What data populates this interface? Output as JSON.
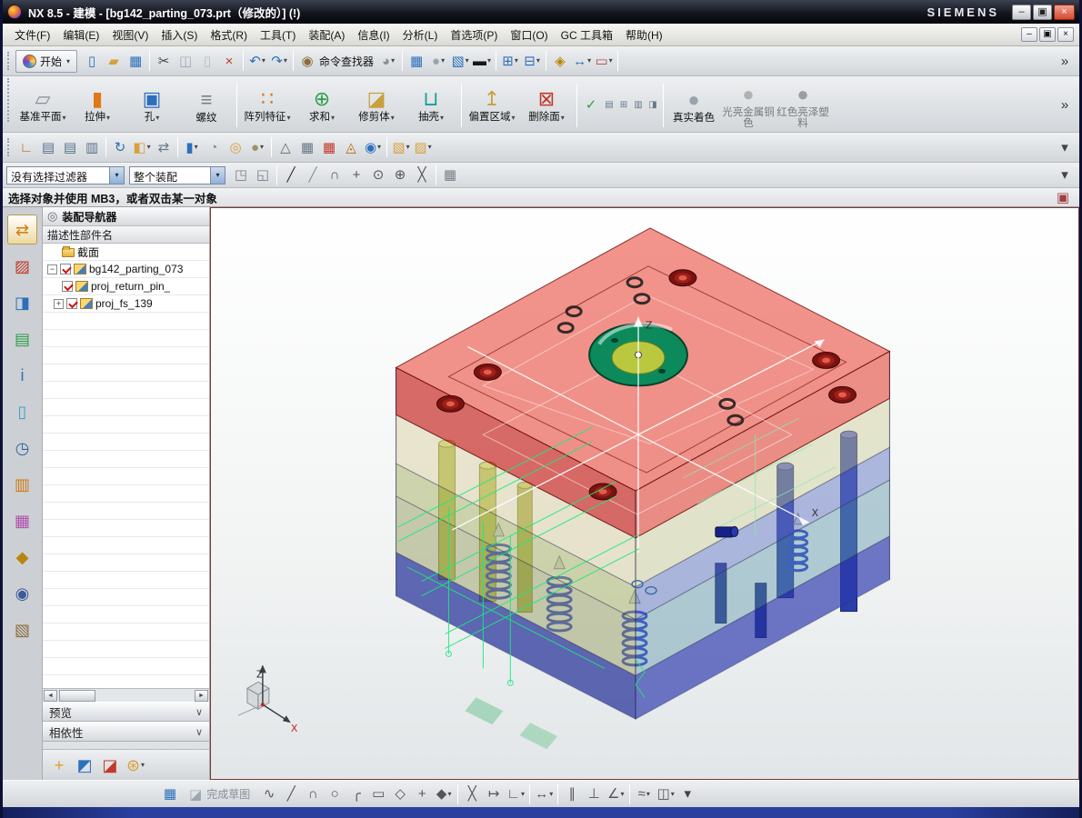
{
  "window": {
    "title": "NX 8.5 - 建模 - [bg142_parting_073.prt（修改的）] (!)",
    "brand": "SIEMENS"
  },
  "glyphs": {
    "overflow": "»",
    "chevron": "∨",
    "exp_open": "−",
    "exp_closed": "+",
    "sleft": "◄",
    "sright": "►",
    "combo": "▾",
    "min": "–",
    "restore": "▣",
    "close": "×",
    "nav": "◎"
  },
  "menu": {
    "items": [
      "文件(F)",
      "编辑(E)",
      "视图(V)",
      "插入(S)",
      "格式(R)",
      "工具(T)",
      "装配(A)",
      "信息(I)",
      "分析(L)",
      "首选项(P)",
      "窗口(O)",
      "GC 工具箱",
      "帮助(H)"
    ]
  },
  "toolbar1": {
    "start": "开始",
    "command_finder": "命令查找器",
    "a": [
      {
        "n": "new-file",
        "g": "▯",
        "c": "#2d6fbb"
      },
      {
        "n": "open-folder",
        "g": "▰",
        "c": "#d9a03c"
      },
      {
        "n": "save",
        "g": "▦",
        "c": "#2d6fbb"
      },
      {
        "sep": true
      },
      {
        "n": "cut",
        "g": "✂",
        "c": "#444444"
      },
      {
        "n": "copy",
        "g": "◫",
        "c": "#2d6fbb",
        "dis": true
      },
      {
        "n": "paste",
        "g": "▯",
        "c": "#8a8f98",
        "dis": true
      },
      {
        "n": "delete",
        "g": "×",
        "c": "#c0392b"
      },
      {
        "sep": true
      },
      {
        "n": "undo",
        "g": "↶",
        "c": "#2d6fbb",
        "dd": true
      },
      {
        "n": "redo",
        "g": "↷",
        "c": "#2d6fbb",
        "dd": true
      },
      {
        "sep": true
      },
      {
        "n": "command-finder",
        "g": "◉",
        "c": "#8a6d3b"
      }
    ],
    "b": [
      {
        "n": "sketch-curve-tool",
        "g": "◕",
        "c": "#8a8f98",
        "dd": true
      },
      {
        "sep": true
      },
      {
        "n": "view-layout",
        "g": "▦",
        "c": "#2d6fbb"
      },
      {
        "n": "shaded-view",
        "g": "●",
        "c": "#9aa4ae",
        "dd": true
      },
      {
        "n": "view-cube",
        "g": "▧",
        "c": "#2d6fbb",
        "dd": true
      },
      {
        "n": "view-background",
        "g": "▬",
        "c": "#15161c",
        "dd": true
      },
      {
        "sep": true
      },
      {
        "n": "window-cascade",
        "g": "⊞",
        "c": "#2d6fbb",
        "dd": true
      },
      {
        "n": "window-tile",
        "g": "⊟",
        "c": "#2d6fbb",
        "dd": true
      },
      {
        "sep": true
      },
      {
        "n": "snap-orient",
        "g": "◈",
        "c": "#b8860b"
      },
      {
        "n": "measure-distance",
        "g": "↔",
        "c": "#2d6fbb",
        "dd": true
      },
      {
        "n": "dimension-tool",
        "g": "▭",
        "c": "#b0484a",
        "dd": true
      },
      {
        "sep": true
      },
      {
        "flex": true
      },
      {
        "n": "toolbar1-overflow",
        "g": "»",
        "c": "#333333"
      }
    ]
  },
  "features": {
    "items": [
      {
        "n": "datum-plane",
        "g": "▱",
        "c": "#8a8f98",
        "label": "基准平面",
        "dd": true
      },
      {
        "n": "extrude",
        "g": "▮",
        "c": "#e07818",
        "label": "拉伸",
        "dd": true
      },
      {
        "n": "hole",
        "g": "▣",
        "c": "#2d6fbb",
        "label": "孔",
        "dd": true
      },
      {
        "n": "thread",
        "g": "≡",
        "c": "#7a7f87",
        "label": "螺纹"
      },
      {
        "sep": true
      },
      {
        "n": "pattern-feature",
        "g": "∷",
        "c": "#e07818",
        "label": "阵列特征",
        "dd": true
      },
      {
        "n": "unite",
        "g": "⊕",
        "c": "#2e9e4a",
        "label": "求和",
        "dd": true
      },
      {
        "n": "trim-body",
        "g": "◪",
        "c": "#c8a03c",
        "label": "修剪体",
        "dd": true
      },
      {
        "n": "shell",
        "g": "⊔",
        "c": "#18a098",
        "label": "抽壳",
        "dd": true
      },
      {
        "sep": true
      },
      {
        "n": "offset-region",
        "g": "↥",
        "c": "#c8a03c",
        "label": "偏置区域",
        "dd": true
      },
      {
        "n": "delete-face",
        "g": "⊠",
        "c": "#c0392b",
        "label": "删除面",
        "dd": true
      },
      {
        "sep": true
      },
      {
        "n": "synchronous-check",
        "g": "✓",
        "c": "#2e9e4a"
      },
      {
        "n": "sync-a",
        "g": "▤",
        "c": "#667788",
        "sm": true
      },
      {
        "n": "sync-b",
        "g": "⊞",
        "c": "#667788",
        "sm": true
      },
      {
        "n": "sync-c",
        "g": "▥",
        "c": "#667788",
        "sm": true
      },
      {
        "n": "sync-d",
        "g": "◨",
        "c": "#667788",
        "sm": true
      },
      {
        "sep": true
      },
      {
        "n": "true-shading",
        "g": "●",
        "c": "#9aa4ae",
        "label": "真实着色"
      },
      {
        "n": "copper-shading",
        "g": "●",
        "c": "#b87333",
        "label": "光亮金属铜色",
        "dis": true
      },
      {
        "n": "red-plastic-shading",
        "g": "●",
        "c": "#c0392b",
        "label": "红色亮泽塑料",
        "dis": true
      },
      {
        "flex": true
      },
      {
        "n": "features-overflow",
        "g": "»",
        "c": "#333333"
      }
    ]
  },
  "toolbar3": {
    "icons": [
      {
        "n": "datum-csys",
        "g": "∟",
        "c": "#c06a10"
      },
      {
        "n": "layer-settings",
        "g": "▤",
        "c": "#55718a"
      },
      {
        "n": "view-in-layer",
        "g": "▤",
        "c": "#55718a"
      },
      {
        "n": "layer-category",
        "g": "▥",
        "c": "#55718a"
      },
      {
        "sep": true
      },
      {
        "n": "rotate-view",
        "g": "↻",
        "c": "#2d6fbb"
      },
      {
        "n": "orient-view",
        "g": "◧",
        "c": "#d9a03c",
        "dd": true
      },
      {
        "n": "swap-view",
        "g": "⇄",
        "c": "#6a7c8a"
      },
      {
        "sep": true
      },
      {
        "n": "show-hide",
        "g": "▮",
        "c": "#2d6fbb",
        "dd": true
      },
      {
        "n": "edit-object-display",
        "g": "◔",
        "c": "#8a8f98"
      },
      {
        "n": "move-object",
        "g": "◎",
        "c": "#d9a03c"
      },
      {
        "n": "material-sphere",
        "g": "●",
        "c": "#a08f6a",
        "dd": true
      },
      {
        "sep": true
      },
      {
        "n": "triangle-tool",
        "g": "△",
        "c": "#666666"
      },
      {
        "n": "spreadsheet",
        "g": "▦",
        "c": "#667788"
      },
      {
        "n": "spreadsheet-marked",
        "g": "▦",
        "c": "#c0392b"
      },
      {
        "n": "deviation-gauge",
        "g": "◬",
        "c": "#c06a10"
      },
      {
        "n": "circle-tools",
        "g": "◉",
        "c": "#2d6fbb",
        "dd": true
      },
      {
        "sep": true
      },
      {
        "n": "udf-box-a",
        "g": "▧",
        "c": "#d9a03c",
        "dd": true
      },
      {
        "n": "udf-box-b",
        "g": "▨",
        "c": "#d9a03c",
        "dd": true
      },
      {
        "flex": true
      },
      {
        "n": "toolbar3-overflow",
        "g": "▾",
        "c": "#444444"
      }
    ]
  },
  "selection_bar": {
    "filter": "没有选择过滤器",
    "scope": "整个装配",
    "icons": [
      {
        "n": "select-solid-face",
        "g": "◳",
        "c": "#7a7f87"
      },
      {
        "n": "select-solid-body",
        "g": "◱",
        "c": "#7a7f87"
      },
      {
        "sep": true
      },
      {
        "n": "snap-endpoint",
        "g": "╱",
        "c": "#333333"
      },
      {
        "n": "snap-midpoint",
        "g": "╱",
        "c": "#8a8f98"
      },
      {
        "n": "snap-arc",
        "g": "∩",
        "c": "#555555"
      },
      {
        "n": "snap-point",
        "g": "+",
        "c": "#555555"
      },
      {
        "n": "snap-center",
        "g": "⊙",
        "c": "#555555"
      },
      {
        "n": "snap-quadrant",
        "g": "⊕",
        "c": "#555555"
      },
      {
        "n": "snap-intersection",
        "g": "╳",
        "c": "#555555"
      },
      {
        "sep": true
      },
      {
        "n": "snap-grid",
        "g": "▦",
        "c": "#7a7f87"
      },
      {
        "flex": true
      },
      {
        "n": "selection-overflow",
        "g": "▾",
        "c": "#444444"
      }
    ]
  },
  "prompt": {
    "text": "选择对象并使用 MB3，或者双击某一对象",
    "icons": [
      {
        "n": "prompt-dock",
        "g": "▣",
        "c": "#a04040"
      }
    ]
  },
  "strip": {
    "icons": [
      {
        "n": "assembly-navigator-tab",
        "g": "⇄",
        "c": "#d07a10",
        "sel": true
      },
      {
        "n": "constraint-navigator-tab",
        "g": "▨",
        "c": "#c0392b"
      },
      {
        "n": "hd3d-tool-tab",
        "g": "◨",
        "c": "#2d6fbb"
      },
      {
        "n": "part-navigator-tab",
        "g": "▤",
        "c": "#2e9e4a"
      },
      {
        "n": "info-browser-tab",
        "g": "i",
        "c": "#2d6fbb"
      },
      {
        "n": "history-palette-tab",
        "g": "▯",
        "c": "#3aa0c8"
      },
      {
        "n": "system-clock-tab",
        "g": "◷",
        "c": "#336699"
      },
      {
        "n": "process-studio-tab",
        "g": "▥",
        "c": "#d07a10"
      },
      {
        "n": "palette-colors-tab",
        "g": "▦",
        "c": "#b050b0"
      },
      {
        "n": "roles-tab",
        "g": "◆",
        "c": "#b8860b"
      },
      {
        "n": "groups-tab",
        "g": "◉",
        "c": "#3a5a9a"
      },
      {
        "n": "notes-tab",
        "g": "▧",
        "c": "#8a6d3b"
      }
    ]
  },
  "navigator": {
    "title": "装配导航器",
    "column": "描述性部件名",
    "nodes": {
      "folder": "截面",
      "root": "bg142_parting_073",
      "child1": "proj_return_pin_",
      "child2": "proj_fs_139"
    },
    "preview": "预览",
    "dependencies": "相依性"
  },
  "mini": {
    "icons": [
      {
        "n": "add-component",
        "g": "+",
        "c": "#e0a020"
      },
      {
        "n": "mirror-assembly",
        "g": "◩",
        "c": "#2d6fbb"
      },
      {
        "n": "flip-display",
        "g": "◪",
        "c": "#c0392b"
      },
      {
        "n": "assembly-gear",
        "g": "⊛",
        "c": "#d9a03c",
        "dd": true
      }
    ]
  },
  "sketch": {
    "finish": "完成草图",
    "pre": [
      {
        "n": "sketch-grid",
        "g": "▦",
        "c": "#2d6fbb"
      }
    ],
    "icons": [
      {
        "n": "profile",
        "g": "∿",
        "c": "#555555"
      },
      {
        "n": "line",
        "g": "╱",
        "c": "#555555"
      },
      {
        "n": "arc",
        "g": "∩",
        "c": "#555555"
      },
      {
        "n": "circle",
        "g": "○",
        "c": "#555555"
      },
      {
        "n": "fillet",
        "g": "╭",
        "c": "#555555"
      },
      {
        "n": "rectangle",
        "g": "▭",
        "c": "#555555"
      },
      {
        "n": "polygon",
        "g": "◇",
        "c": "#555555"
      },
      {
        "n": "point",
        "g": "+",
        "c": "#555555"
      },
      {
        "n": "more-curves",
        "g": "◆",
        "c": "#555555",
        "dd": true
      },
      {
        "sep": true
      },
      {
        "n": "quick-trim",
        "g": "╳",
        "c": "#555555"
      },
      {
        "n": "quick-extend",
        "g": "↦",
        "c": "#555555"
      },
      {
        "n": "make-corner",
        "g": "∟",
        "c": "#555555",
        "dd": true
      },
      {
        "sep": true
      },
      {
        "n": "rapid-dimension",
        "g": "↔",
        "c": "#555555",
        "dd": true
      },
      {
        "sep": true
      },
      {
        "n": "parallel-constraint",
        "g": "∥",
        "c": "#555555"
      },
      {
        "n": "perpendicular-constraint",
        "g": "⊥",
        "c": "#555555"
      },
      {
        "n": "more-constraints",
        "g": "∠",
        "c": "#555555",
        "dd": true
      },
      {
        "sep": true
      },
      {
        "n": "offset-curve",
        "g": "≈",
        "c": "#555555",
        "dd": true
      },
      {
        "n": "pattern-curve",
        "g": "◫",
        "c": "#555555",
        "dd": true
      },
      {
        "n": "sketch-overflow",
        "g": "▾",
        "c": "#444444"
      }
    ]
  },
  "viewport": {
    "wcs": {
      "z": "Z",
      "x": "X"
    },
    "triad": {
      "z": "Z",
      "x": "X"
    }
  },
  "colors": {
    "check_red": "#cc1111",
    "viewport_border": "#7a3a30",
    "close_red": "#d6492f"
  }
}
